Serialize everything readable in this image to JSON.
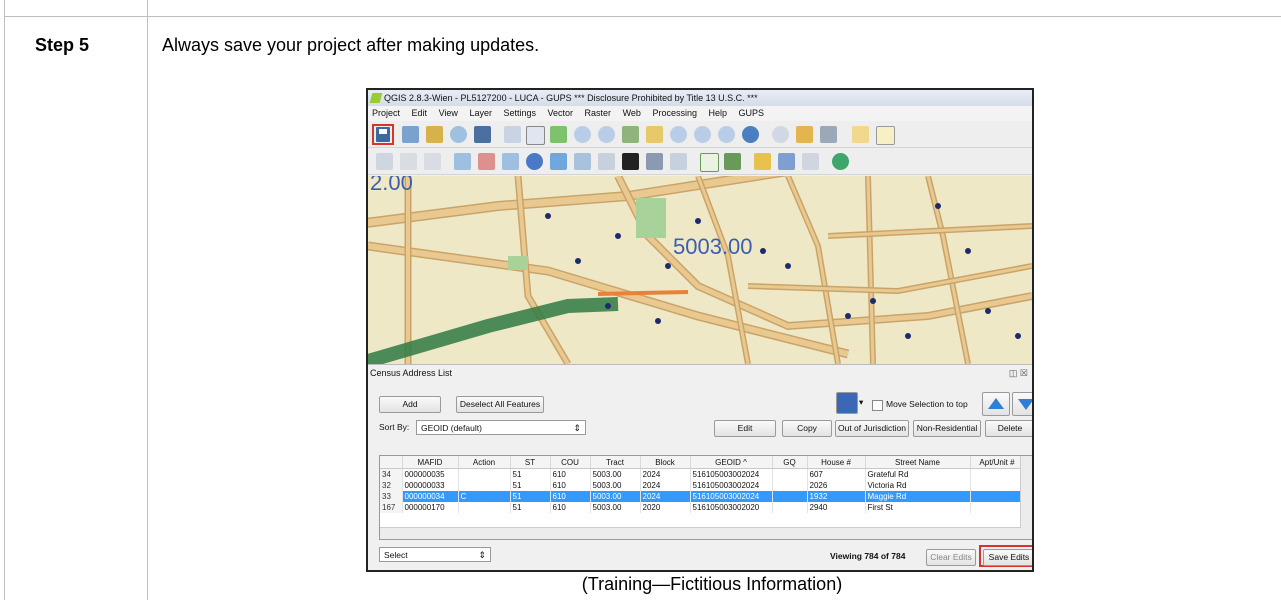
{
  "step": {
    "label": "Step 5",
    "instruction": "Always save your project after making updates."
  },
  "caption": "(Training—Fictitious Information)",
  "window": {
    "title": "QGIS 2.8.3-Wien - PL5127200 - LUCA - GUPS    *** Disclosure Prohibited by Title 13 U.S.C. ***",
    "menu": [
      "Project",
      "Edit",
      "View",
      "Layer",
      "Settings",
      "Vector",
      "Raster",
      "Web",
      "Processing",
      "Help",
      "GUPS"
    ]
  },
  "map": {
    "tract_label": "5003.00",
    "corner_label": "2.00"
  },
  "panel": {
    "title": "Census Address List",
    "add_label": "Add",
    "deselect_label": "Deselect All Features",
    "move_selection_label": "Move Selection to top",
    "sort_by_label": "Sort By:",
    "sort_by_value": "GEOID (default)",
    "edit_label": "Edit",
    "copy_label": "Copy",
    "out_of_jurisdiction_label": "Out of Jurisdiction",
    "non_residential_label": "Non-Residential",
    "delete_label": "Delete",
    "select_value": "Select",
    "viewing_text": "Viewing 784 of 784",
    "clear_edits_label": "Clear Edits",
    "save_edits_label": "Save Edits"
  },
  "table": {
    "columns": [
      "MAFID",
      "Action",
      "ST",
      "COU",
      "Tract",
      "Block",
      "GEOID",
      "GQ",
      "House #",
      "Street Name",
      "Apt/Unit #"
    ],
    "rows": [
      {
        "row": "34",
        "mafid": "000000035",
        "action": "",
        "st": "51",
        "cou": "610",
        "tract": "5003.00",
        "block": "2024",
        "geoid": "516105003002024",
        "gq": "",
        "house": "607",
        "street": "Grateful Rd",
        "apt": ""
      },
      {
        "row": "32",
        "mafid": "000000033",
        "action": "",
        "st": "51",
        "cou": "610",
        "tract": "5003.00",
        "block": "2024",
        "geoid": "516105003002024",
        "gq": "",
        "house": "2026",
        "street": "Victoria Rd",
        "apt": ""
      },
      {
        "row": "33",
        "mafid": "000000034",
        "action": "C",
        "st": "51",
        "cou": "610",
        "tract": "5003.00",
        "block": "2024",
        "geoid": "516105003002024",
        "gq": "",
        "house": "1932",
        "street": "Maggie Rd",
        "apt": ""
      },
      {
        "row": "167",
        "mafid": "000000170",
        "action": "",
        "st": "51",
        "cou": "610",
        "tract": "5003.00",
        "block": "2020",
        "geoid": "516105003002020",
        "gq": "",
        "house": "2940",
        "street": "First St",
        "apt": ""
      }
    ]
  },
  "colors": {
    "highlight": "#d9342b",
    "selection": "#3399ff",
    "map_background": "#efe8c6",
    "road": "#e9c98f",
    "road_outline": "#c9a46a"
  }
}
